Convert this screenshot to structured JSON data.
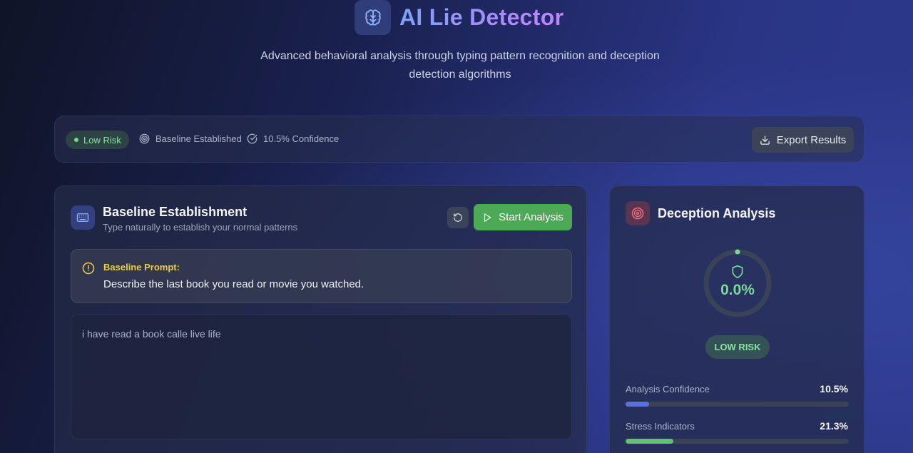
{
  "header": {
    "title": "AI Lie Detector",
    "subtitle": "Advanced behavioral analysis through typing pattern recognition and deception detection algorithms",
    "logo_icon": "brain-icon"
  },
  "status_bar": {
    "risk_label": "Low Risk",
    "baseline_status": "Baseline Established",
    "confidence": "10.5% Confidence",
    "export_label": "Export Results"
  },
  "baseline_panel": {
    "title": "Baseline Establishment",
    "subtitle": "Type naturally to establish your normal patterns",
    "start_label": "Start Analysis",
    "prompt_label": "Baseline Prompt:",
    "prompt_text": "Describe the last book you read or movie you watched.",
    "typed_text": "i have read a book calle live life"
  },
  "deception_panel": {
    "title": "Deception Analysis",
    "gauge_value": "0.0%",
    "gauge_fraction": 0.0,
    "risk_badge": "LOW RISK",
    "metrics": [
      {
        "label": "Analysis Confidence",
        "value": "10.5%",
        "fraction": 0.105,
        "color": "#5b6ee8"
      },
      {
        "label": "Stress Indicators",
        "value": "21.3%",
        "fraction": 0.213,
        "color": "#5cc46d"
      }
    ]
  },
  "colors": {
    "accent_green": "#4caa57",
    "risk_green": "#86e3a0",
    "warning_yellow": "#f2c94c",
    "title_gradient_start": "#7ea2f5",
    "title_gradient_end": "#c084fc"
  }
}
